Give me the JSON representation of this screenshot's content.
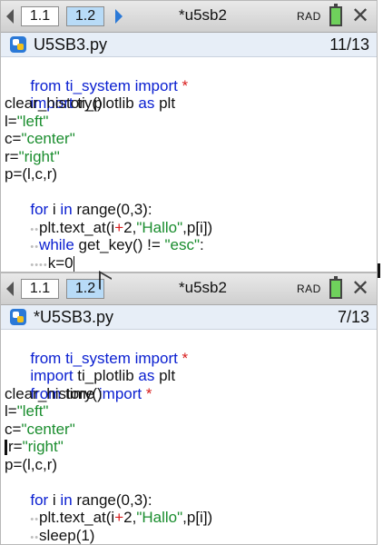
{
  "top_panel": {
    "tabs": [
      "1.1",
      "1.2"
    ],
    "title": "*u5sb2",
    "rad": "RAD",
    "file": "U5SB3.py",
    "position": "11/13",
    "code": {
      "l1_a": "from ti_system ",
      "l1_b": "import",
      "l1_c": " *",
      "l2_a": "import",
      "l2_b": " ti_plotlib ",
      "l2_c": "as",
      "l2_d": " plt",
      "l3": "clear_history()",
      "l4_a": "l=",
      "l4_b": "\"left\"",
      "l5_a": "c=",
      "l5_b": "\"center\"",
      "l6_a": "r=",
      "l6_b": "\"right\"",
      "l7": "p=(l,c,r)",
      "l8_a": "for",
      "l8_b": " i ",
      "l8_c": "in",
      "l8_d": " range(0,3):",
      "l9_a": "plt.text_at(i",
      "l9_b": "+",
      "l9_c": "2,",
      "l9_d": "\"Hallo\"",
      "l9_e": ",p[i])",
      "l10_a": "while",
      "l10_b": " get_key() != ",
      "l10_c": "\"esc\"",
      "l10_d": ":",
      "l11": "k=0"
    }
  },
  "bottom_panel": {
    "tabs": [
      "1.1",
      "1.2"
    ],
    "title": "*u5sb2",
    "rad": "RAD",
    "file": "*U5SB3.py",
    "position": "7/13",
    "code": {
      "l1_a": "from ti_system ",
      "l1_b": "import",
      "l1_c": " *",
      "l2_a": "import",
      "l2_b": " ti_plotlib ",
      "l2_c": "as",
      "l2_d": " plt",
      "l3_a": "from",
      "l3_b": " time ",
      "l3_c": "import",
      "l3_d": " *",
      "l4": "clear_history()",
      "l5_a": "l=",
      "l5_b": "\"left\"",
      "l6_a": "c=",
      "l6_b": "\"center\"",
      "l7_a": "r=",
      "l7_b": "\"right\"",
      "l8": "p=(l,c,r)",
      "l9_a": "for",
      "l9_b": " i ",
      "l9_c": "in",
      "l9_d": " range(0,3):",
      "l10_a": "plt.text_at(i",
      "l10_b": "+",
      "l10_c": "2,",
      "l10_d": "\"Hallo\"",
      "l10_e": ",p[i])",
      "l11": "sleep(1)"
    }
  },
  "dots2": "••",
  "dots4": "••••"
}
